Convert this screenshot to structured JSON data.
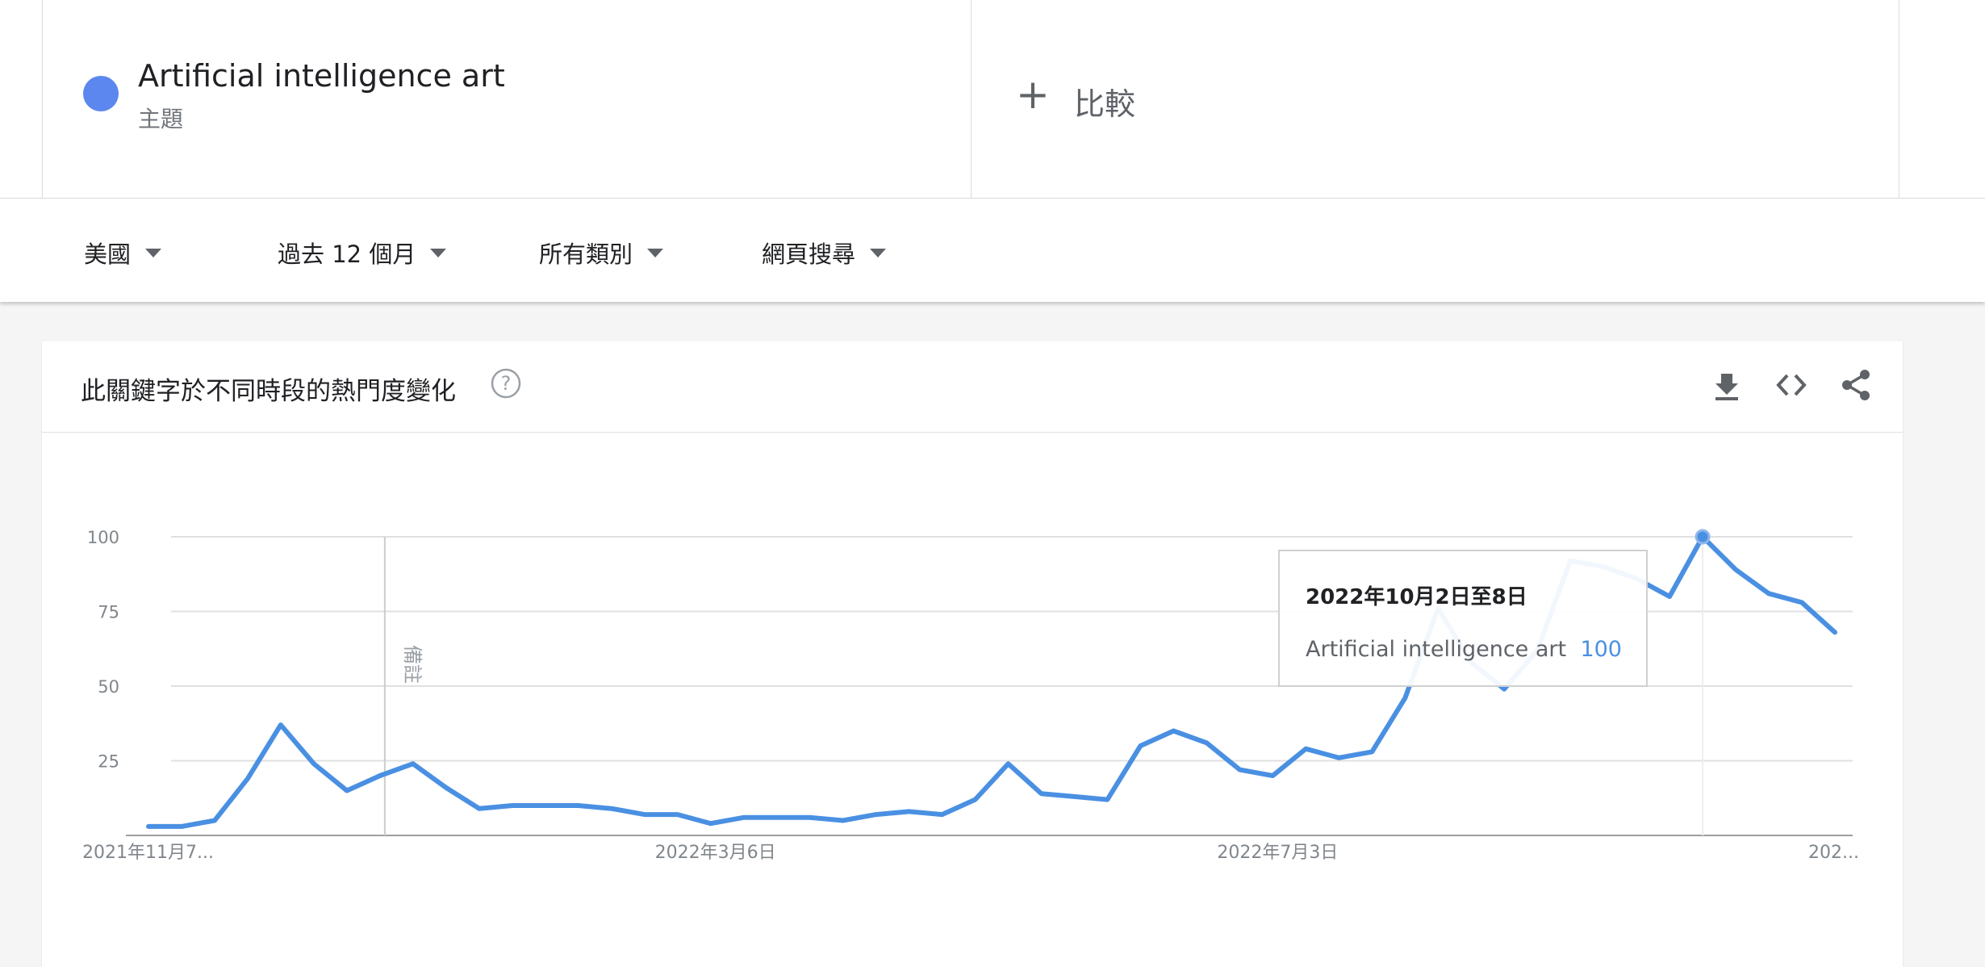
{
  "search_term": {
    "name": "Artificial intelligence art",
    "type": "主題",
    "color": "#5b87ee"
  },
  "compare": {
    "label": "比較"
  },
  "filters": [
    {
      "label": "美國"
    },
    {
      "label": "過去 12 個月"
    },
    {
      "label": "所有類別"
    },
    {
      "label": "網頁搜尋"
    }
  ],
  "card": {
    "title": "此關鍵字於不同時段的熱門度變化",
    "icons": [
      "help-icon",
      "download-icon",
      "embed-icon",
      "share-icon"
    ]
  },
  "tooltip": {
    "date": "2022年10月2日至8日",
    "series": "Artificial intelligence art",
    "value": "100"
  },
  "chart_data": {
    "type": "line",
    "title": "",
    "ylim": [
      0,
      100
    ],
    "y_ticks": [
      "100",
      "75",
      "50",
      "25"
    ],
    "x_tick_labels": [
      "2021年11月7...",
      "2022年3月6日",
      "2022年7月3日",
      "202..."
    ],
    "note_marker": {
      "label": "備註",
      "index": 7
    },
    "highlight_index": 47,
    "grid": true,
    "line_color": "#4a90e2",
    "x_first": "2021年11月7日",
    "x_interval": "1 week",
    "series": [
      {
        "name": "Artificial intelligence art",
        "values": [
          3,
          3,
          5,
          19,
          37,
          24,
          15,
          20,
          24,
          16,
          9,
          10,
          10,
          10,
          9,
          7,
          7,
          4,
          6,
          6,
          6,
          5,
          7,
          8,
          7,
          12,
          24,
          14,
          13,
          12,
          30,
          35,
          31,
          22,
          20,
          29,
          26,
          28,
          46,
          76,
          58,
          49,
          62,
          92,
          90,
          86,
          80,
          100,
          89,
          81,
          78,
          68
        ]
      }
    ]
  }
}
